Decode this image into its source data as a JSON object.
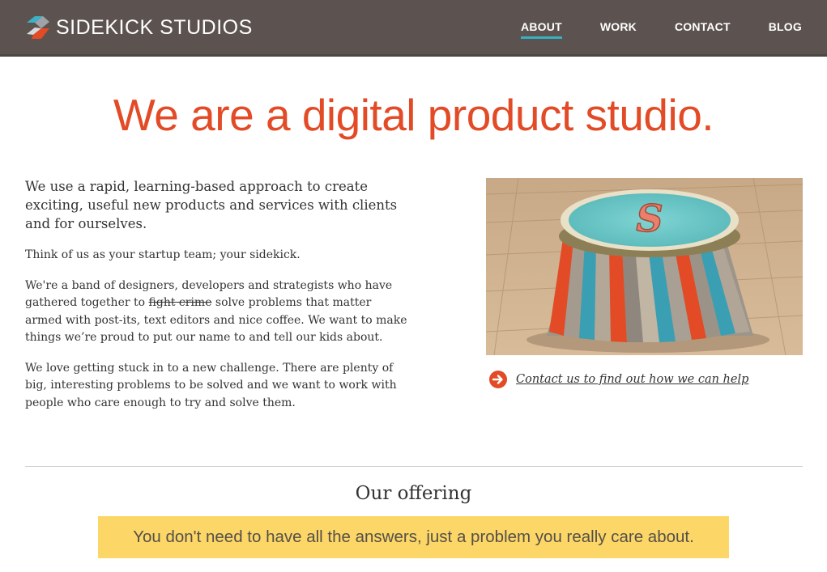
{
  "brand": {
    "name": "SIDEKICK STUDIOS"
  },
  "nav": {
    "items": [
      {
        "label": "ABOUT",
        "active": true
      },
      {
        "label": "WORK",
        "active": false
      },
      {
        "label": "CONTACT",
        "active": false
      },
      {
        "label": "BLOG",
        "active": false
      }
    ]
  },
  "hero": {
    "headline": "We are a digital product studio."
  },
  "intro": {
    "lead": "We use a rapid, learning-based approach to create exciting, useful new products and services with clients and for ourselves.",
    "p1": "Think of us as your startup team; your sidekick.",
    "p2_before": "We're a band of designers, developers and strategists who have gathered together to ",
    "p2_strike": "fight crime",
    "p2_after": " solve problems that matter armed with post-its, text editors and nice coffee. We want to make things we’re proud to put our name to and tell our kids about.",
    "p3": "We love getting stuck in to a new challenge. There are plenty of big, interesting problems to be solved and we want to work with people who care enough to try and solve them."
  },
  "photo": {
    "icon": "sidekick-stool-photo",
    "letter": "S"
  },
  "cta": {
    "label": "Contact us to find out how we can help",
    "icon": "arrow-circle-icon"
  },
  "offering": {
    "title": "Our offering",
    "banner": "You don't need to have all the answers, just a problem you really care about."
  },
  "colors": {
    "header_bg": "#5c5350",
    "accent_orange": "#e24b26",
    "accent_teal": "#36b1c3",
    "banner_yellow": "#fcd667"
  }
}
